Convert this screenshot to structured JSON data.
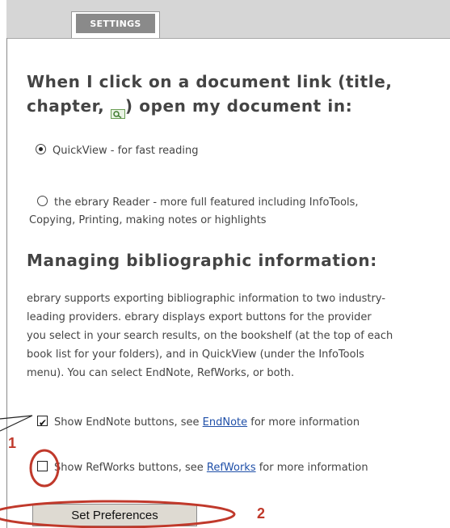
{
  "tab": {
    "label": "SETTINGS"
  },
  "section1": {
    "heading_line1": "When I click on a document link (title,",
    "heading_line2_a": "chapter, ",
    "heading_line2_b": ") open my document in:",
    "options": [
      {
        "label": "QuickView - for fast reading",
        "selected": true
      },
      {
        "label_line1": "the ebrary Reader - more full featured including InfoTools,",
        "label_line2": "Copying, Printing, making notes or highlights",
        "selected": false
      }
    ]
  },
  "section2": {
    "heading": "Managing bibliographic information:",
    "paragraph": [
      "ebrary supports exporting bibliographic information to two industry-",
      "leading providers. ebrary displays export buttons for the provider",
      "you select in your search results, on the bookshelf (at the top of each",
      "book list for your folders), and in QuickView (under the InfoTools",
      "menu). You can select EndNote, RefWorks, or both."
    ],
    "endnote": {
      "pre": "Show EndNote buttons, see ",
      "link": "EndNote",
      "post": " for more information",
      "checked": true
    },
    "refworks": {
      "pre": "Show RefWorks buttons, see ",
      "link": "RefWorks",
      "post": " for more information",
      "checked": false
    }
  },
  "button": {
    "label": "Set Preferences"
  },
  "annotations": {
    "num1": "1",
    "num2": "2",
    "color": "#c0392b"
  }
}
